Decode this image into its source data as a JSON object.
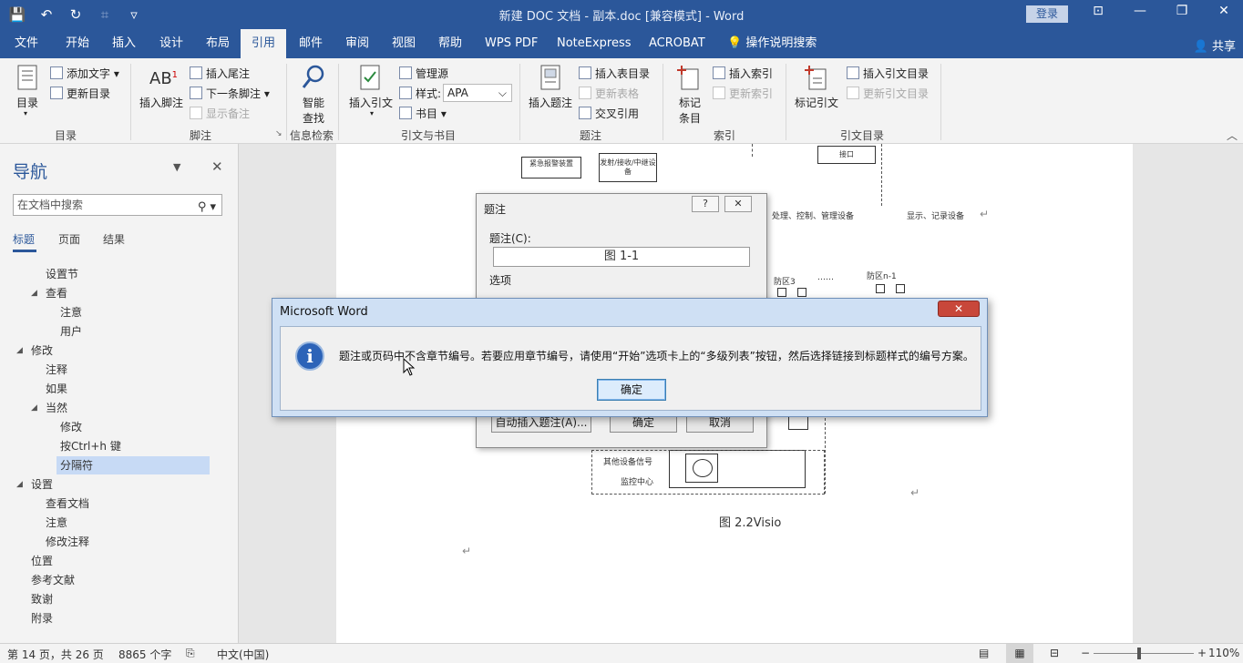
{
  "titlebar": {
    "title": "新建 DOC 文档 - 副本.doc [兼容模式]  -  Word",
    "login": "登录",
    "qat": {
      "save": "💾",
      "undo": "↶",
      "redo": "↻",
      "touch": "⌗",
      "customize": "▿"
    },
    "win": {
      "ribbon_opts": "⊡",
      "minimize": "—",
      "restore": "❐",
      "close": "✕"
    }
  },
  "tabs": [
    "文件",
    "开始",
    "插入",
    "设计",
    "布局",
    "引用",
    "邮件",
    "审阅",
    "视图",
    "帮助",
    "WPS PDF",
    "NoteExpress",
    "ACROBAT",
    "操作说明搜索"
  ],
  "active_tab": "引用",
  "share": "共享",
  "ribbon": {
    "toc": {
      "big": "目录",
      "add_text": "添加文字",
      "update_toc": "更新目录",
      "group": "目录"
    },
    "footnote": {
      "big": "插入脚注",
      "insert_endnote": "插入尾注",
      "next_footnote": "下一条脚注",
      "show_notes": "显示备注",
      "group": "脚注"
    },
    "research": {
      "big1": "智能",
      "big2": "查找",
      "group": "信息检索"
    },
    "citation": {
      "big": "插入引文",
      "manage_sources": "管理源",
      "style_label": "样式:",
      "style_value": "APA",
      "bibliography": "书目",
      "group": "引文与书目"
    },
    "caption": {
      "big": "插入题注",
      "insert_tof": "插入表目录",
      "update_table": "更新表格",
      "cross_ref": "交叉引用",
      "group": "题注"
    },
    "index": {
      "big1": "标记",
      "big2": "条目",
      "insert_index": "插入索引",
      "update_index": "更新索引",
      "group": "索引"
    },
    "toa": {
      "big": "标记引文",
      "insert_toa": "插入引文目录",
      "update_toa": "更新引文目录",
      "group": "引文目录"
    }
  },
  "nav": {
    "title": "导航",
    "search_placeholder": "在文档中搜索",
    "tabs": [
      "标题",
      "页面",
      "结果"
    ],
    "items": [
      {
        "label": "设置节",
        "level": 2
      },
      {
        "label": "查看",
        "level": 1,
        "expanded": true
      },
      {
        "label": "注意",
        "level": 3
      },
      {
        "label": "用户",
        "level": 3
      },
      {
        "label": "修改",
        "level": 0,
        "expanded": true
      },
      {
        "label": "注释",
        "level": 2
      },
      {
        "label": "如果",
        "level": 2
      },
      {
        "label": "当然",
        "level": 1,
        "expanded": true
      },
      {
        "label": "修改",
        "level": 3
      },
      {
        "label": "按Ctrl+h 键",
        "level": 3
      },
      {
        "label": "分隔符",
        "level": 3,
        "selected": true
      },
      {
        "label": "设置",
        "level": 0,
        "expanded": true
      },
      {
        "label": "查看文档",
        "level": 2
      },
      {
        "label": "注意",
        "level": 2
      },
      {
        "label": "修改注释",
        "level": 2
      },
      {
        "label": "位置",
        "level": 1
      },
      {
        "label": "参考文献",
        "level": 1
      },
      {
        "label": "致谢",
        "level": 1
      },
      {
        "label": "附录",
        "level": 1
      }
    ]
  },
  "document": {
    "boxes": {
      "alarm": "紧急报警装置",
      "transceiver": "发射/接收/中继设备",
      "interface": "接口"
    },
    "labels": {
      "processing": "处理、控制、管理设备",
      "display": "显示、记录设备",
      "zone3": "防区3",
      "dots": "……",
      "zonen": "防区n-1",
      "other_signal": "其他设备信号",
      "monitor": "监控中心"
    },
    "caption": "图 2.2Visio",
    "para_mark": "↵"
  },
  "caption_dialog": {
    "title": "题注",
    "help": "?",
    "close": "✕",
    "caption_label": "题注(C):",
    "caption_value": "图  1-1",
    "options_label": "选项",
    "autocaption": "自动插入题注(A)...",
    "ok": "确定",
    "cancel": "取消"
  },
  "message_box": {
    "title": "Microsoft Word",
    "close": "✕",
    "icon": "i",
    "text": "题注或页码中不含章节编号。若要应用章节编号，请使用“开始”选项卡上的“多级列表”按钮，然后选择链接到标题样式的编号方案。",
    "ok": "确定"
  },
  "statusbar": {
    "page": "第 14 页，共 26 页",
    "words": "8865 个字",
    "language": "中文(中国)",
    "zoom_minus": "−",
    "zoom_plus": "+",
    "zoom": "110%"
  }
}
